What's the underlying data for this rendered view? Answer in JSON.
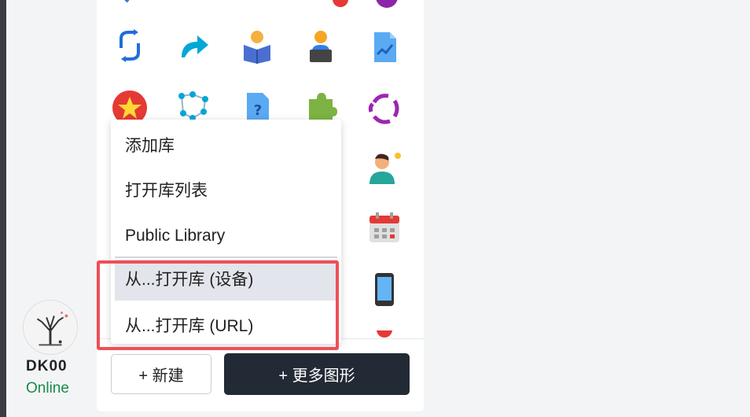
{
  "menu": {
    "items": [
      "添加库",
      "打开库列表",
      "Public Library",
      "从...打开库 (设备)",
      "从...打开库 (URL)"
    ],
    "selected_index": 3
  },
  "buttons": {
    "new_label": "+ 新建",
    "more_shapes_label": "+ 更多图形"
  },
  "user": {
    "name": "DK00",
    "status": "Online"
  },
  "icons": [
    "sync-icon",
    "share-arrow-icon",
    "reader-icon",
    "laptop-user-icon",
    "chart-document-icon",
    "star-badge-icon",
    "network-icon",
    "help-document-icon",
    "puzzle-icon",
    "refresh-cycle-icon",
    "user-idea-icon",
    "calendar-icon",
    "mobile-phone-icon"
  ],
  "colors": {
    "highlight": "#ef4f56",
    "primary_button": "#222a35",
    "online": "#1a8a4a"
  }
}
